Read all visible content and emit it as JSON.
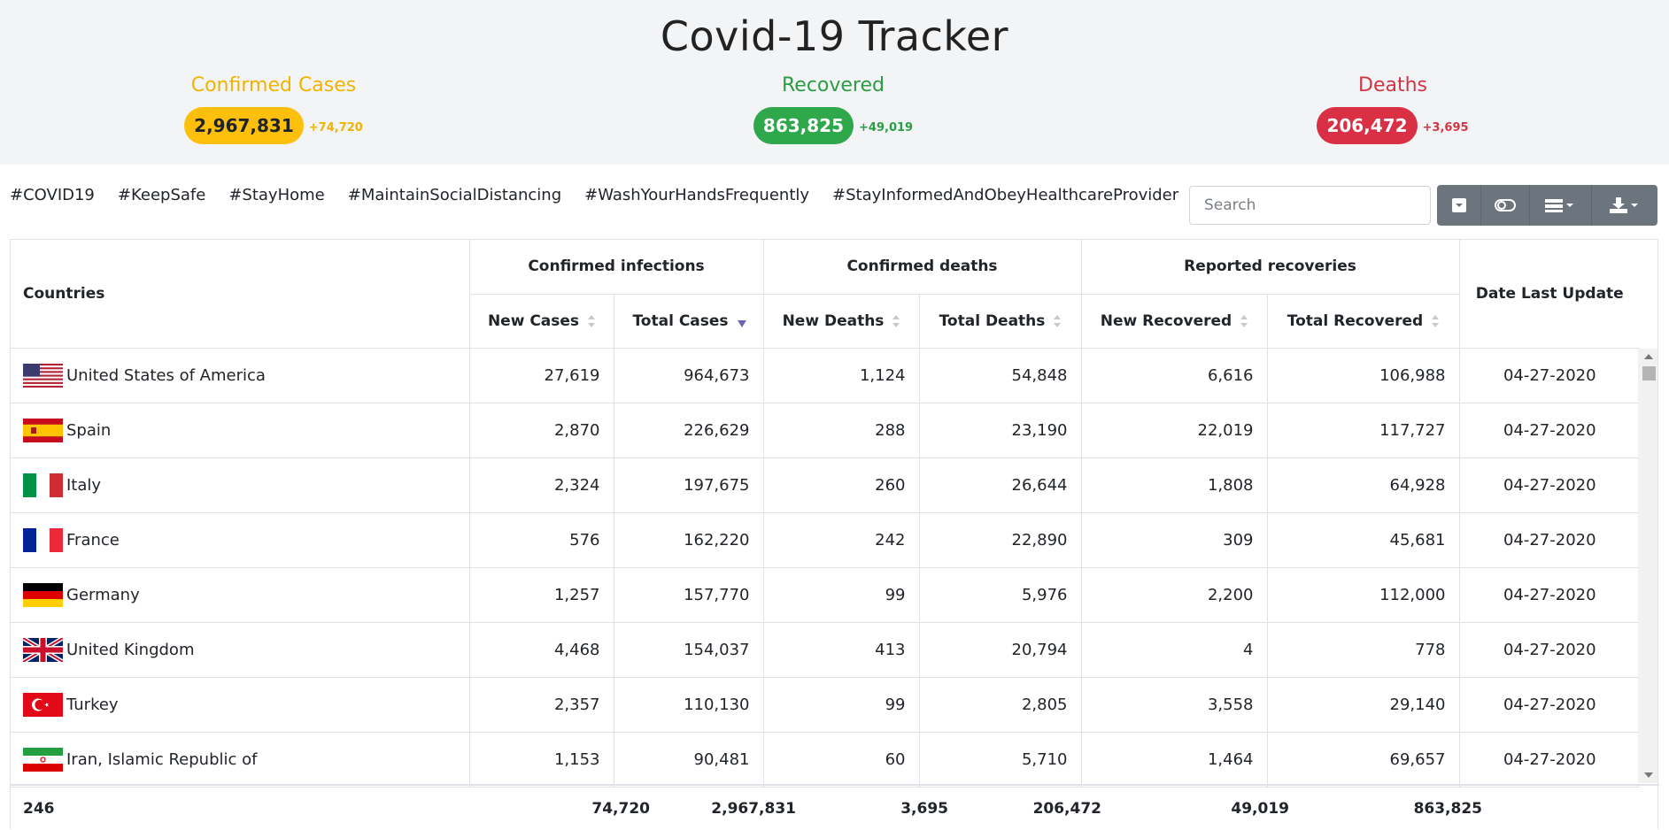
{
  "app": {
    "title": "Covid-19 Tracker"
  },
  "summary": {
    "confirmed": {
      "label": "Confirmed Cases",
      "value": "2,967,831",
      "delta": "+74,720",
      "color": "#fbbf0c"
    },
    "recovered": {
      "label": "Recovered",
      "value": "863,825",
      "delta": "+49,019",
      "color": "#2ea84a"
    },
    "deaths": {
      "label": "Deaths",
      "value": "206,472",
      "delta": "+3,695",
      "color": "#d93045"
    }
  },
  "hashtags": [
    "#COVID19",
    "#KeepSafe",
    "#StayHome",
    "#MaintainSocialDistancing",
    "#WashYourHandsFrequently",
    "#StayInformedAndObeyHealthcareProvider"
  ],
  "search": {
    "placeholder": "Search"
  },
  "toolbar": {
    "buttons": [
      {
        "icon": "collapse-square-icon"
      },
      {
        "icon": "toggle-switch-icon"
      },
      {
        "icon": "columns-list-icon"
      },
      {
        "icon": "download-icon"
      }
    ]
  },
  "table": {
    "group_headers": {
      "countries": "Countries",
      "confirmed_infections": "Confirmed infections",
      "confirmed_deaths": "Confirmed deaths",
      "reported_recoveries": "Reported recoveries",
      "date_last_update": "Date Last Update"
    },
    "columns": {
      "new_cases": "New Cases",
      "total_cases": "Total Cases",
      "new_deaths": "New Deaths",
      "total_deaths": "Total Deaths",
      "new_recovered": "New Recovered",
      "total_recovered": "Total Recovered"
    },
    "sort": {
      "column": "Total Cases",
      "direction": "desc"
    },
    "rows": [
      {
        "country": "United States of America",
        "flag": "us-flag-icon",
        "new_cases": "27,619",
        "total_cases": "964,673",
        "new_deaths": "1,124",
        "total_deaths": "54,848",
        "new_recovered": "6,616",
        "total_recovered": "106,988",
        "date": "04-27-2020"
      },
      {
        "country": "Spain",
        "flag": "spain-flag-icon",
        "new_cases": "2,870",
        "total_cases": "226,629",
        "new_deaths": "288",
        "total_deaths": "23,190",
        "new_recovered": "22,019",
        "total_recovered": "117,727",
        "date": "04-27-2020"
      },
      {
        "country": "Italy",
        "flag": "italy-flag-icon",
        "new_cases": "2,324",
        "total_cases": "197,675",
        "new_deaths": "260",
        "total_deaths": "26,644",
        "new_recovered": "1,808",
        "total_recovered": "64,928",
        "date": "04-27-2020"
      },
      {
        "country": "France",
        "flag": "france-flag-icon",
        "new_cases": "576",
        "total_cases": "162,220",
        "new_deaths": "242",
        "total_deaths": "22,890",
        "new_recovered": "309",
        "total_recovered": "45,681",
        "date": "04-27-2020"
      },
      {
        "country": "Germany",
        "flag": "germany-flag-icon",
        "new_cases": "1,257",
        "total_cases": "157,770",
        "new_deaths": "99",
        "total_deaths": "5,976",
        "new_recovered": "2,200",
        "total_recovered": "112,000",
        "date": "04-27-2020"
      },
      {
        "country": "United Kingdom",
        "flag": "uk-flag-icon",
        "new_cases": "4,468",
        "total_cases": "154,037",
        "new_deaths": "413",
        "total_deaths": "20,794",
        "new_recovered": "4",
        "total_recovered": "778",
        "date": "04-27-2020"
      },
      {
        "country": "Turkey",
        "flag": "turkey-flag-icon",
        "new_cases": "2,357",
        "total_cases": "110,130",
        "new_deaths": "99",
        "total_deaths": "2,805",
        "new_recovered": "3,558",
        "total_recovered": "29,140",
        "date": "04-27-2020"
      },
      {
        "country": "Iran, Islamic Republic of",
        "flag": "iran-flag-icon",
        "new_cases": "1,153",
        "total_cases": "90,481",
        "new_deaths": "60",
        "total_deaths": "5,710",
        "new_recovered": "1,464",
        "total_recovered": "69,657",
        "date": "04-27-2020"
      }
    ],
    "footer": {
      "countries": "246",
      "new_cases": "74,720",
      "total_cases": "2,967,831",
      "new_deaths": "3,695",
      "total_deaths": "206,472",
      "new_recovered": "49,019",
      "total_recovered": "863,825"
    }
  }
}
